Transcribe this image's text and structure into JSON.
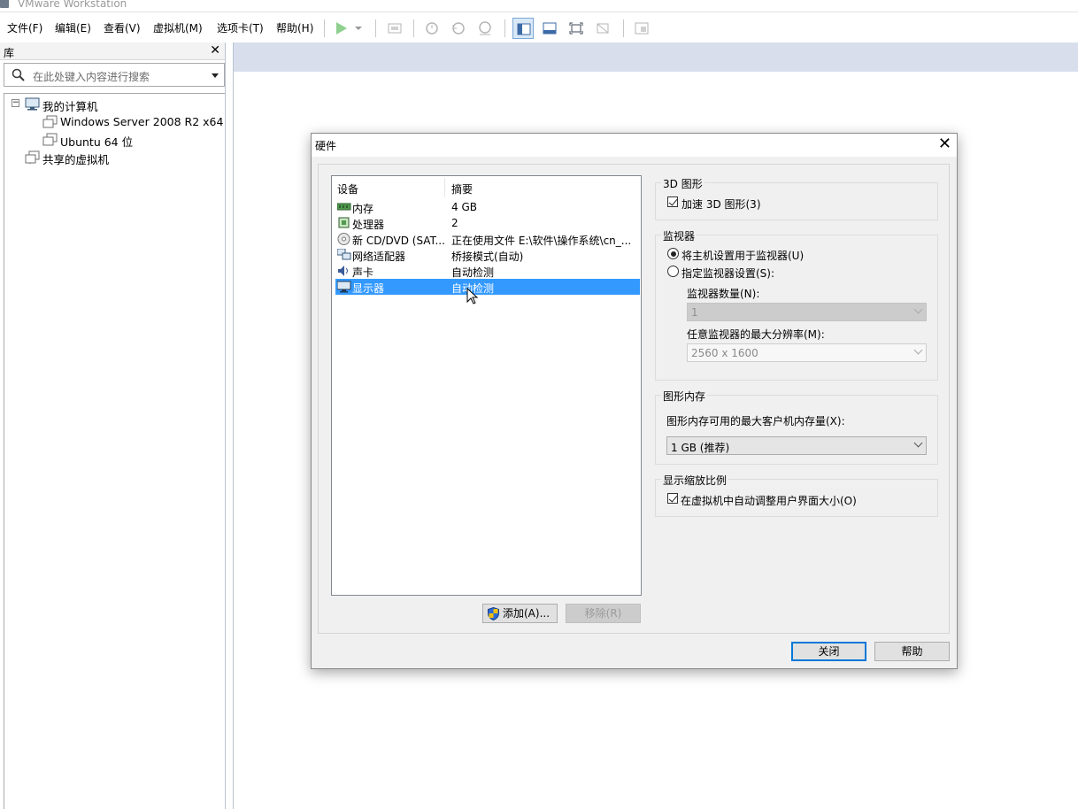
{
  "window": {
    "title": "VMware Workstation"
  },
  "menubar": {
    "items": [
      "文件(F)",
      "编辑(E)",
      "查看(V)",
      "虚拟机(M)",
      "选项卡(T)",
      "帮助(H)"
    ]
  },
  "library": {
    "title": "库",
    "close": "✕",
    "search_placeholder": "在此处键入内容进行搜索",
    "tree": {
      "root": "我的计算机",
      "vms": [
        "Windows Server 2008 R2 x64",
        "Ubuntu 64 位"
      ],
      "shared": "共享的虚拟机"
    }
  },
  "dialog": {
    "title": "硬件",
    "close": "✕",
    "device_list": {
      "col_device": "设备",
      "col_summary": "摘要",
      "rows": [
        {
          "name": "内存",
          "summary": "4 GB",
          "icon": "memory-icon"
        },
        {
          "name": "处理器",
          "summary": "2",
          "icon": "processor-icon"
        },
        {
          "name": "新 CD/DVD (SAT...",
          "summary": "正在使用文件 E:\\软件\\操作系统\\cn_...",
          "icon": "cd-dvd-icon"
        },
        {
          "name": "网络适配器",
          "summary": "桥接模式(自动)",
          "icon": "network-adapter-icon"
        },
        {
          "name": "声卡",
          "summary": "自动检测",
          "icon": "sound-card-icon"
        },
        {
          "name": "显示器",
          "summary": "自动检测",
          "icon": "display-icon"
        }
      ],
      "selected_index": 5
    },
    "add_button": "添加(A)...",
    "remove_button": "移除(R)",
    "graphics_3d": {
      "title": "3D 图形",
      "accelerate_label": "加速 3D 图形(3)",
      "accelerate_checked": true
    },
    "monitors": {
      "title": "监视器",
      "option_host": "将主机设置用于监视器(U)",
      "option_specify": "指定监视器设置(S):",
      "selected": "host",
      "count_label": "监视器数量(N):",
      "count_value": "1",
      "max_res_label": "任意监视器的最大分辨率(M):",
      "max_res_value": "2560 x 1600"
    },
    "graphics_memory": {
      "title": "图形内存",
      "label": "图形内存可用的最大客户机内存量(X):",
      "value": "1 GB (推荐)"
    },
    "display_scaling": {
      "title": "显示缩放比例",
      "label": "在虚拟机中自动调整用户界面大小(O)",
      "checked": true
    },
    "close_button": "关闭",
    "help_button": "帮助"
  }
}
